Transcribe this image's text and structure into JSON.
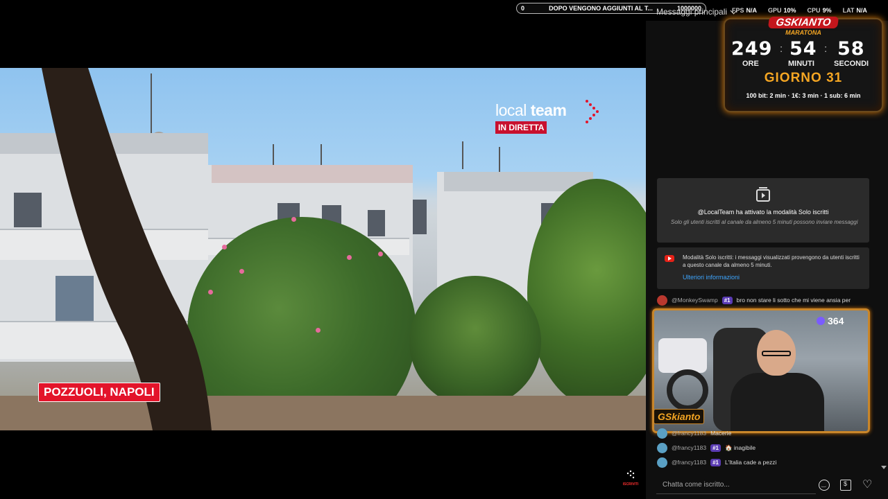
{
  "ticker": {
    "left_value": "0",
    "message": "DOPO VENGONO AGGIUNTI AL T...",
    "right_value": "1000000",
    "progress": 0.0
  },
  "chat_header": {
    "title": "Messaggi principali"
  },
  "stats": [
    {
      "label": "FPS",
      "value": "N/A"
    },
    {
      "label": "GPU",
      "value": "10%"
    },
    {
      "label": "CPU",
      "value": "9%"
    },
    {
      "label": "LAT",
      "value": "N/A"
    }
  ],
  "video": {
    "logo_name_light": "local",
    "logo_name_bold": "team",
    "logo_live": "IN DIRETTA",
    "location": "POZZUOLI, NAPOLI",
    "watermark": "ISCRIVITI"
  },
  "timer": {
    "title": "GSKIANTO",
    "subtitle": "MARATONA",
    "hours": "249",
    "minutes": "54",
    "seconds": "58",
    "hours_label": "ORE",
    "minutes_label": "MINUTI",
    "seconds_label": "SECONDI",
    "day": "GIORNO 31",
    "rates": "100 bit: 2 min · 1€: 3 min · 1 sub: 6 min"
  },
  "notice": {
    "title": "@LocalTeam ha attivato la modalità Solo iscritti",
    "body": "Solo gli utenti iscritti al canale da almeno 5 minuti possono inviare messaggi"
  },
  "info": {
    "text": "Modalità Solo iscritti: i messaggi visualizzati provengono da utenti iscritti a questo canale da almeno 5 minuti.",
    "link": "Ulteriori informazioni"
  },
  "chat": [
    {
      "user": "@MonkeySwamp",
      "badge": "#1",
      "message": "bro non stare li sotto che mi viene ansia per"
    },
    {
      "user": "@francy1183",
      "badge": "",
      "message": "Macerie"
    },
    {
      "user": "@francy1183",
      "badge": "#1",
      "message": "🏠 inagibile"
    },
    {
      "user": "@francy1183",
      "badge": "#1",
      "message": "L'Italia cade a pezzi"
    }
  ],
  "webcam": {
    "viewers": "364",
    "name": "GSkianto"
  },
  "chat_input": {
    "placeholder": "Chatta come iscritto..."
  },
  "colors": {
    "accent_orange": "#f5a623",
    "live_red": "#c8102e",
    "link_blue": "#3ea6ff",
    "badge_purple": "#5a3bb3"
  }
}
